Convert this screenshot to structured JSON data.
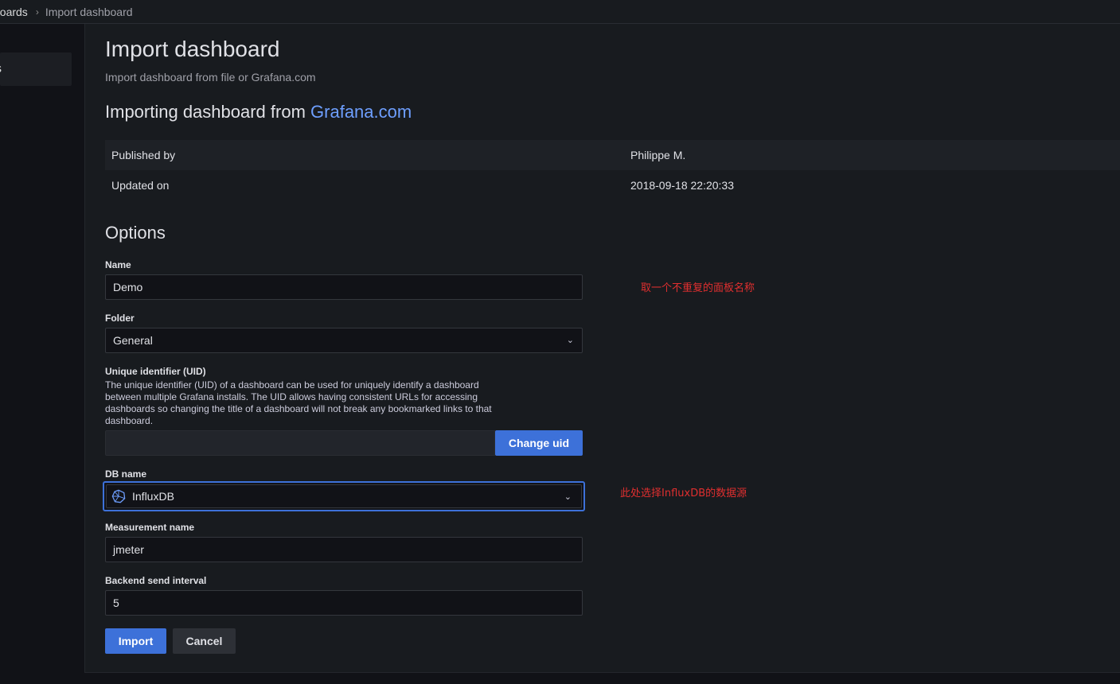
{
  "breadcrumb": {
    "previous": "boards",
    "separator": "›",
    "current": "Import dashboard"
  },
  "sidebar": {
    "active_item_label": "s"
  },
  "page": {
    "title": "Import dashboard",
    "subtitle": "Import dashboard from file or Grafana.com",
    "importing_prefix": "Importing dashboard from ",
    "importing_link": "Grafana.com"
  },
  "info": {
    "rows": [
      {
        "key": "Published by",
        "value": "Philippe M."
      },
      {
        "key": "Updated on",
        "value": "2018-09-18 22:20:33"
      }
    ]
  },
  "options": {
    "heading": "Options",
    "name": {
      "label": "Name",
      "value": "Demo"
    },
    "folder": {
      "label": "Folder",
      "value": "General"
    },
    "uid": {
      "label": "Unique identifier (UID)",
      "description": "The unique identifier (UID) of a dashboard can be used for uniquely identify a dashboard between multiple Grafana installs. The UID allows having consistent URLs for accessing dashboards so changing the title of a dashboard will not break any bookmarked links to that dashboard.",
      "value": "",
      "change_button": "Change uid"
    },
    "db_name": {
      "label": "DB name",
      "value": "InfluxDB"
    },
    "measurement": {
      "label": "Measurement name",
      "value": "jmeter"
    },
    "interval": {
      "label": "Backend send interval",
      "value": "5"
    }
  },
  "actions": {
    "import": "Import",
    "cancel": "Cancel"
  },
  "annotations": {
    "name_note": "取一个不重复的面板名称",
    "db_note": "此处选择InfluxDB的数据源"
  },
  "colors": {
    "accent": "#3d71d9",
    "link": "#6e9fff",
    "annotation": "#e02f2f"
  }
}
